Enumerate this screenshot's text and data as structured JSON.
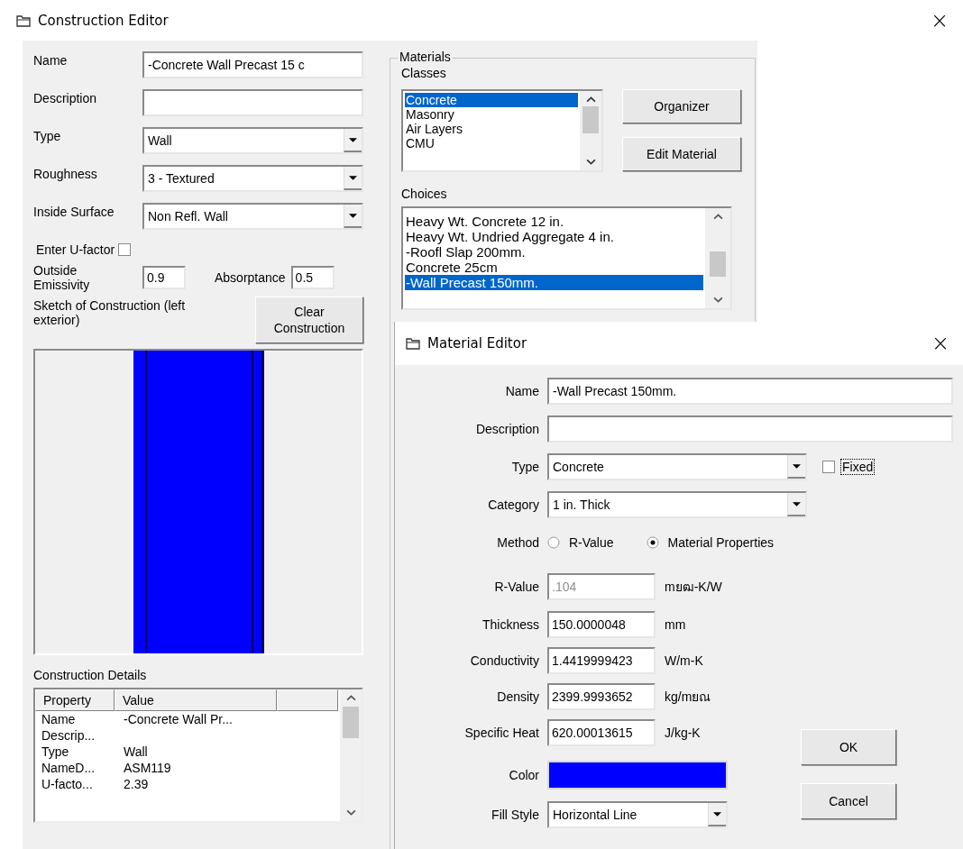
{
  "window": {
    "title": "Construction Editor",
    "close": "×"
  },
  "construction": {
    "fields": [
      {
        "kind": "text",
        "label": "Name",
        "value": "-Concrete Wall Precast 15 c"
      },
      {
        "kind": "text",
        "label": "Description"
      },
      {
        "kind": "dropdown",
        "label": "Type",
        "value": "Wall"
      },
      {
        "kind": "dropdown",
        "label": "Roughness",
        "value": "3 - Textured"
      },
      {
        "kind": "dropdown",
        "label": "Inside Surface",
        "value": "Non Refl. Wall"
      }
    ],
    "u_factor": {
      "label": "Enter U-factor",
      "checked": false
    },
    "emissivity": {
      "label": "Outside Emissivity",
      "value": "0.9"
    },
    "absorptance": {
      "label": "Absorptance",
      "value": "0.5"
    },
    "sketch_label": "Sketch of Construction (left exterior)",
    "clear_button": "Clear Construction",
    "details_label": "Construction Details",
    "details": {
      "columns": [
        "Property",
        "Value"
      ],
      "rows": [
        {
          "property": "Name",
          "value": "-Concrete Wall Pr..."
        },
        {
          "property": "Descrip..."
        },
        {
          "property": "Type",
          "value": "Wall"
        },
        {
          "property": "NameD...",
          "value": "ASM119"
        },
        {
          "property": "U-facto...",
          "value": "2.39"
        }
      ]
    }
  },
  "materials": {
    "title": "Materials",
    "classes_label": "Classes",
    "classes": [
      {
        "label": "Concrete",
        "selected": true
      },
      {
        "label": "Masonry",
        "selected": false
      },
      {
        "label": "Air Layers",
        "selected": false
      },
      {
        "label": "CMU",
        "selected": false
      }
    ],
    "buttons": [
      "Organizer",
      "Edit Material"
    ],
    "choices_label": "Choices",
    "choices": [
      {
        "label": "Heavy Wt. Concrete 12 in.",
        "selected": false
      },
      {
        "label": "Heavy Wt. Undried Aggregate 4 in.",
        "selected": false
      },
      {
        "label": "-Roofl Slap 200mm.",
        "selected": false
      },
      {
        "label": "Concrete 25cm",
        "selected": false
      },
      {
        "label": "-Wall Precast 150mm.",
        "selected": true
      }
    ]
  },
  "material_editor": {
    "title": "Material Editor",
    "close": "×",
    "name": {
      "label": "Name",
      "value": "-Wall Precast 150mm."
    },
    "description": {
      "label": "Description"
    },
    "type": {
      "label": "Type",
      "value": "Concrete"
    },
    "fixed": {
      "label": "Fixed",
      "checked": false
    },
    "category": {
      "label": "Category",
      "value": "1 in. Thick"
    },
    "method": {
      "label": "Method",
      "options": [
        {
          "label": "R-Value",
          "selected": false
        },
        {
          "label": "Material Properties",
          "selected": true
        }
      ]
    },
    "properties": [
      {
        "label": "R-Value",
        "value": ".104",
        "unit": "mยฒ-K/W",
        "disabled": true
      },
      {
        "label": "Thickness",
        "value": "150.0000048",
        "unit": "mm",
        "disabled": false
      },
      {
        "label": "Conductivity",
        "value": "1.4419999423",
        "unit": "W/m-K",
        "disabled": false
      },
      {
        "label": "Density",
        "value": "2399.9993652",
        "unit": "kg/mยณ",
        "disabled": false
      },
      {
        "label": "Specific Heat",
        "value": "620.00013615",
        "unit": "J/kg-K",
        "disabled": false
      }
    ],
    "color": {
      "label": "Color",
      "color": "#0000ff"
    },
    "fill_style": {
      "label": "Fill Style",
      "value": "Horizontal Line"
    },
    "buttons": [
      "OK",
      "Cancel"
    ]
  }
}
